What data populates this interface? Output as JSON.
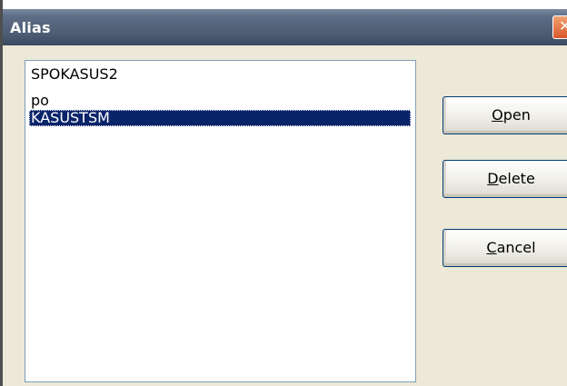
{
  "window": {
    "title": "Alias"
  },
  "alias_list": {
    "items": [
      {
        "label": "SPOKASUS2",
        "selected": false
      },
      {
        "label": "po",
        "selected": false
      },
      {
        "label": "KASUSTSM",
        "selected": true
      }
    ]
  },
  "buttons": {
    "open": {
      "accel": "O",
      "rest": "pen"
    },
    "delete": {
      "accel": "D",
      "rest": "elete"
    },
    "cancel": {
      "accel": "C",
      "rest": "ancel"
    }
  },
  "icons": {
    "close": "close-icon"
  },
  "colors": {
    "titlebar": "#4e5e76",
    "selection": "#0a246a",
    "dialog_bg": "#ece9d8",
    "close_button": "#d9582a"
  }
}
